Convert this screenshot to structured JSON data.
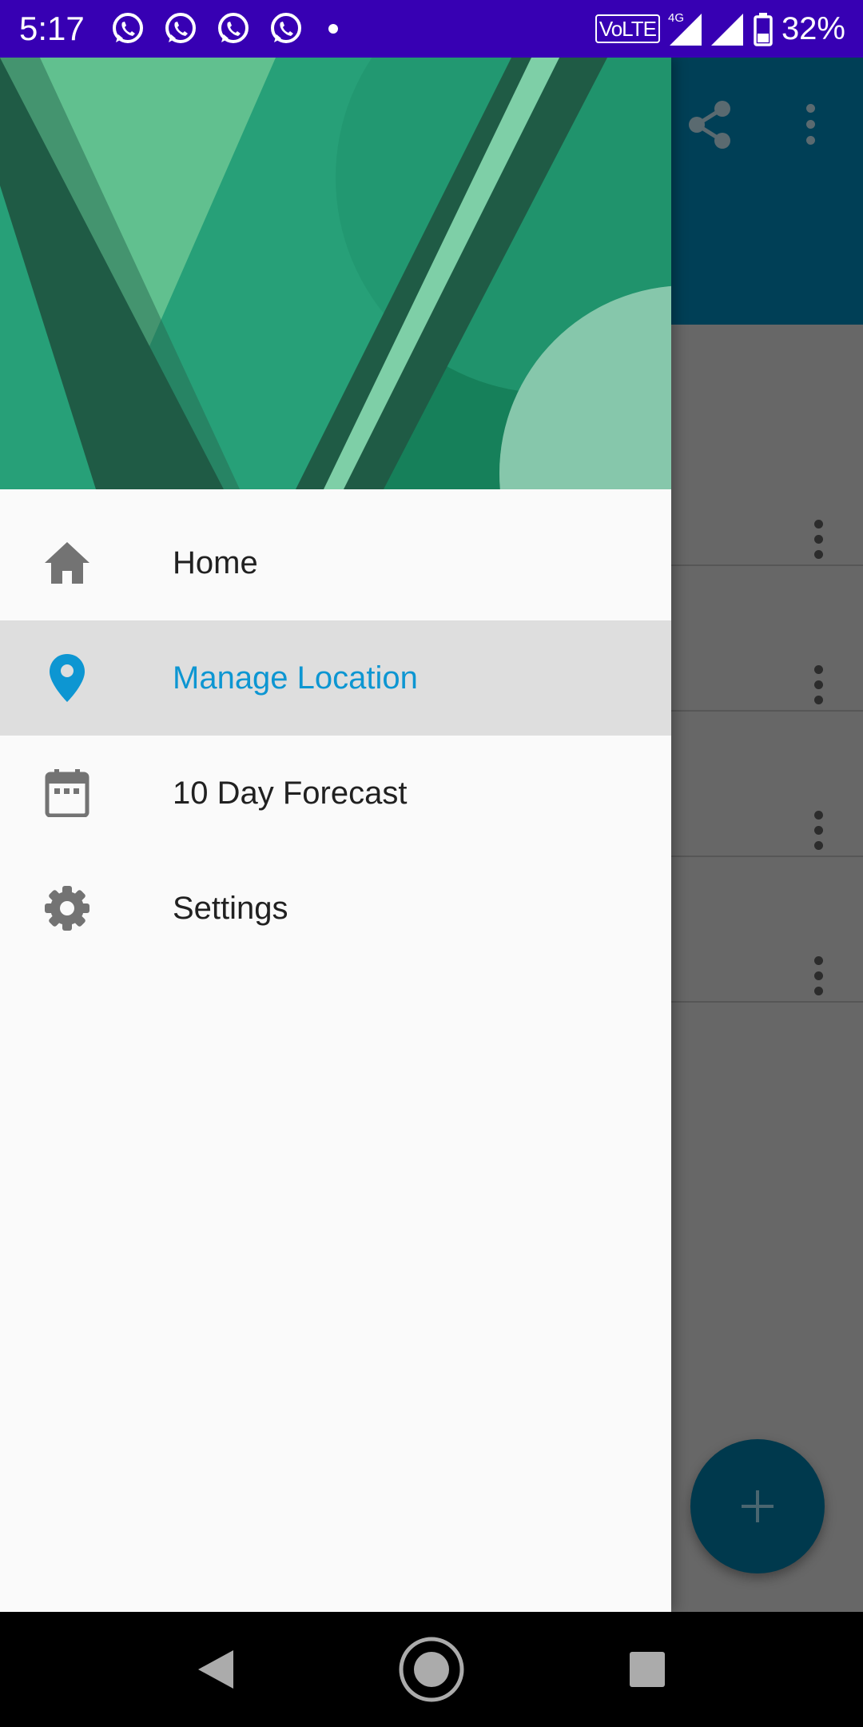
{
  "status_bar": {
    "time": "5:17",
    "notification_icons": [
      "whatsapp-icon",
      "whatsapp-icon",
      "whatsapp-icon",
      "whatsapp-icon",
      "dot-icon"
    ],
    "volte_label": "VoLTE",
    "network_type": "4G",
    "battery_percent": "32%",
    "background_color": "#3700b3"
  },
  "drawer": {
    "menu_items": [
      {
        "label": "Home",
        "icon": "home-icon",
        "active": false
      },
      {
        "label": "Manage Location",
        "icon": "location-pin-icon",
        "active": true
      },
      {
        "label": "10 Day Forecast",
        "icon": "calendar-icon",
        "active": false
      },
      {
        "label": "Settings",
        "icon": "gear-icon",
        "active": false
      }
    ],
    "active_color": "#0d96d2"
  },
  "background_app": {
    "toolbar_color": "#003f56",
    "toolbar_actions": [
      "share-icon",
      "more-vertical-icon"
    ],
    "list_row_count": 4,
    "fab_icon": "plus-icon",
    "fab_color": "#00394d"
  },
  "navigation_bar": {
    "buttons": [
      "back-icon",
      "home-icon",
      "recents-icon"
    ]
  }
}
